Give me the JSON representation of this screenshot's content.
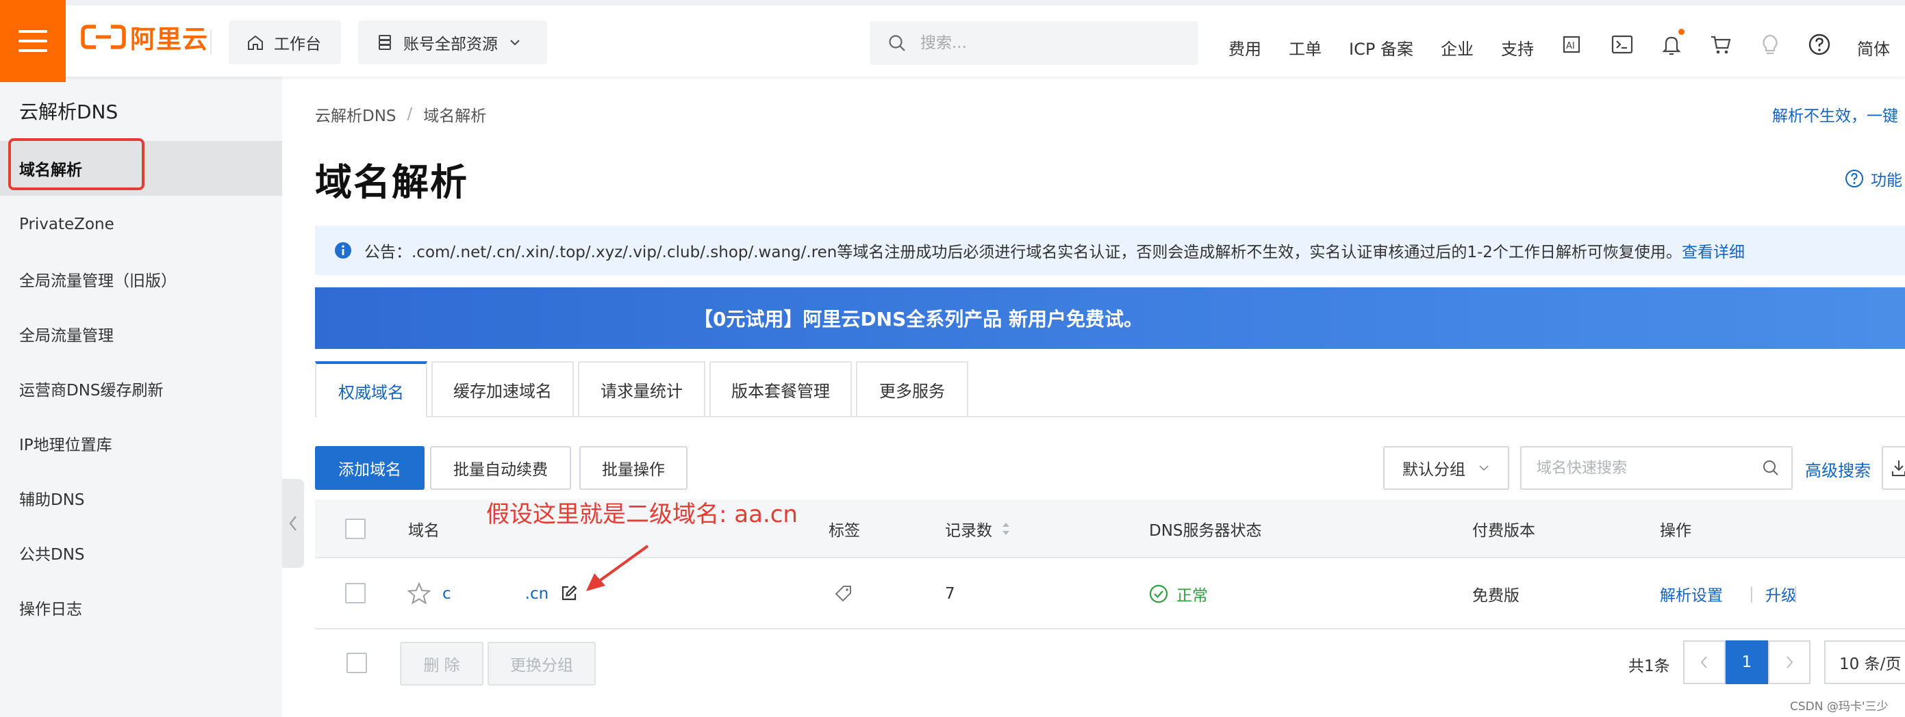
{
  "topbar": {
    "logo_text": "阿里云",
    "workbench_label": "工作台",
    "resources_label": "账号全部资源",
    "search_placeholder": "搜索...",
    "links": [
      "费用",
      "工单",
      "ICP 备案",
      "企业",
      "支持"
    ],
    "lang_label": "简体",
    "brand_color": "#ff6a00"
  },
  "sidebar": {
    "title": "云解析DNS",
    "items": [
      {
        "label": "域名解析",
        "active": true
      },
      {
        "label": "PrivateZone"
      },
      {
        "label": "全局流量管理（旧版）"
      },
      {
        "label": "全局流量管理"
      },
      {
        "label": "运营商DNS缓存刷新"
      },
      {
        "label": "IP地理位置库"
      },
      {
        "label": "辅助DNS"
      },
      {
        "label": "公共DNS"
      },
      {
        "label": "操作日志"
      }
    ]
  },
  "breadcrumb": {
    "items": [
      "云解析DNS",
      "域名解析"
    ],
    "separator": "/"
  },
  "header": {
    "help_link": "解析不生效，一键",
    "title": "域名解析",
    "feature_link": "功能"
  },
  "notice": {
    "text": "公告：.com/.net/.cn/.xin/.top/.xyz/.vip/.club/.shop/.wang/.ren等域名注册成功后必须进行域名实名认证，否则会造成解析不生效，实名认证审核通过后的1-2个工作日解析可恢复使用。",
    "link": "查看详细"
  },
  "banner": {
    "text": "【0元试用】阿里云DNS全系列产品 新用户免费试。"
  },
  "tabs": [
    "权威域名",
    "缓存加速域名",
    "请求量统计",
    "版本套餐管理",
    "更多服务"
  ],
  "toolbar": {
    "add_domain": "添加域名",
    "batch_renew": "批量自动续费",
    "batch_ops": "批量操作",
    "group_select": "默认分组",
    "domain_search_placeholder": "域名快速搜索",
    "advanced_search": "高级搜索"
  },
  "table": {
    "columns": [
      "域名",
      "标签",
      "记录数",
      "DNS服务器状态",
      "付费版本",
      "操作"
    ],
    "rows": [
      {
        "domain_prefix": "c",
        "domain_suffix": ".cn",
        "records": "7",
        "status": "正常",
        "plan": "免费版",
        "actions": [
          "解析设置",
          "升级"
        ]
      }
    ]
  },
  "annotation": "假设这里就是二级域名: aa.cn",
  "footer": {
    "delete_label": "删 除",
    "change_group_label": "更换分组",
    "total": "共1条",
    "current_page": "1",
    "page_size": "10 条/页"
  },
  "watermark": "CSDN @玛卡'三少",
  "colors": {
    "accent": "#1565c0",
    "primary_button": "#1f6fd1",
    "success": "#2e9e3e",
    "annotation": "#e53c35"
  }
}
